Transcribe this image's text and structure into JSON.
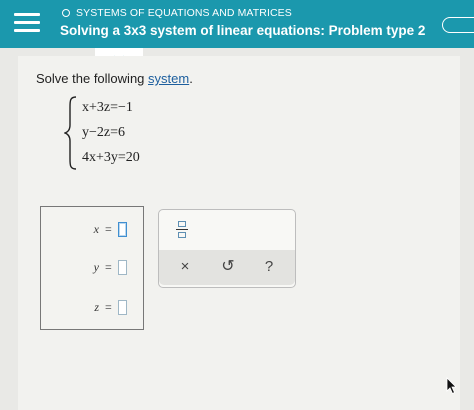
{
  "header": {
    "breadcrumb": "SYSTEMS OF EQUATIONS AND MATRICES",
    "title": "Solving a 3x3 system of linear equations: Problem type 2"
  },
  "problem": {
    "instruction_prefix": "Solve the following ",
    "instruction_link": "system",
    "instruction_suffix": ".",
    "equations": [
      "x+3z=−1",
      "y−2z=6",
      "4x+3y=20"
    ]
  },
  "answer": {
    "rows": [
      {
        "label": "x",
        "equals": "=",
        "value": ""
      },
      {
        "label": "y",
        "equals": "=",
        "value": ""
      },
      {
        "label": "z",
        "equals": "=",
        "value": ""
      }
    ]
  },
  "tools": {
    "clear_glyph": "×",
    "undo_glyph": "↺",
    "help_glyph": "?"
  },
  "colors": {
    "header_bg": "#1b98ad",
    "link": "#1d5f9e",
    "input_focus": "#3f8fd1"
  }
}
